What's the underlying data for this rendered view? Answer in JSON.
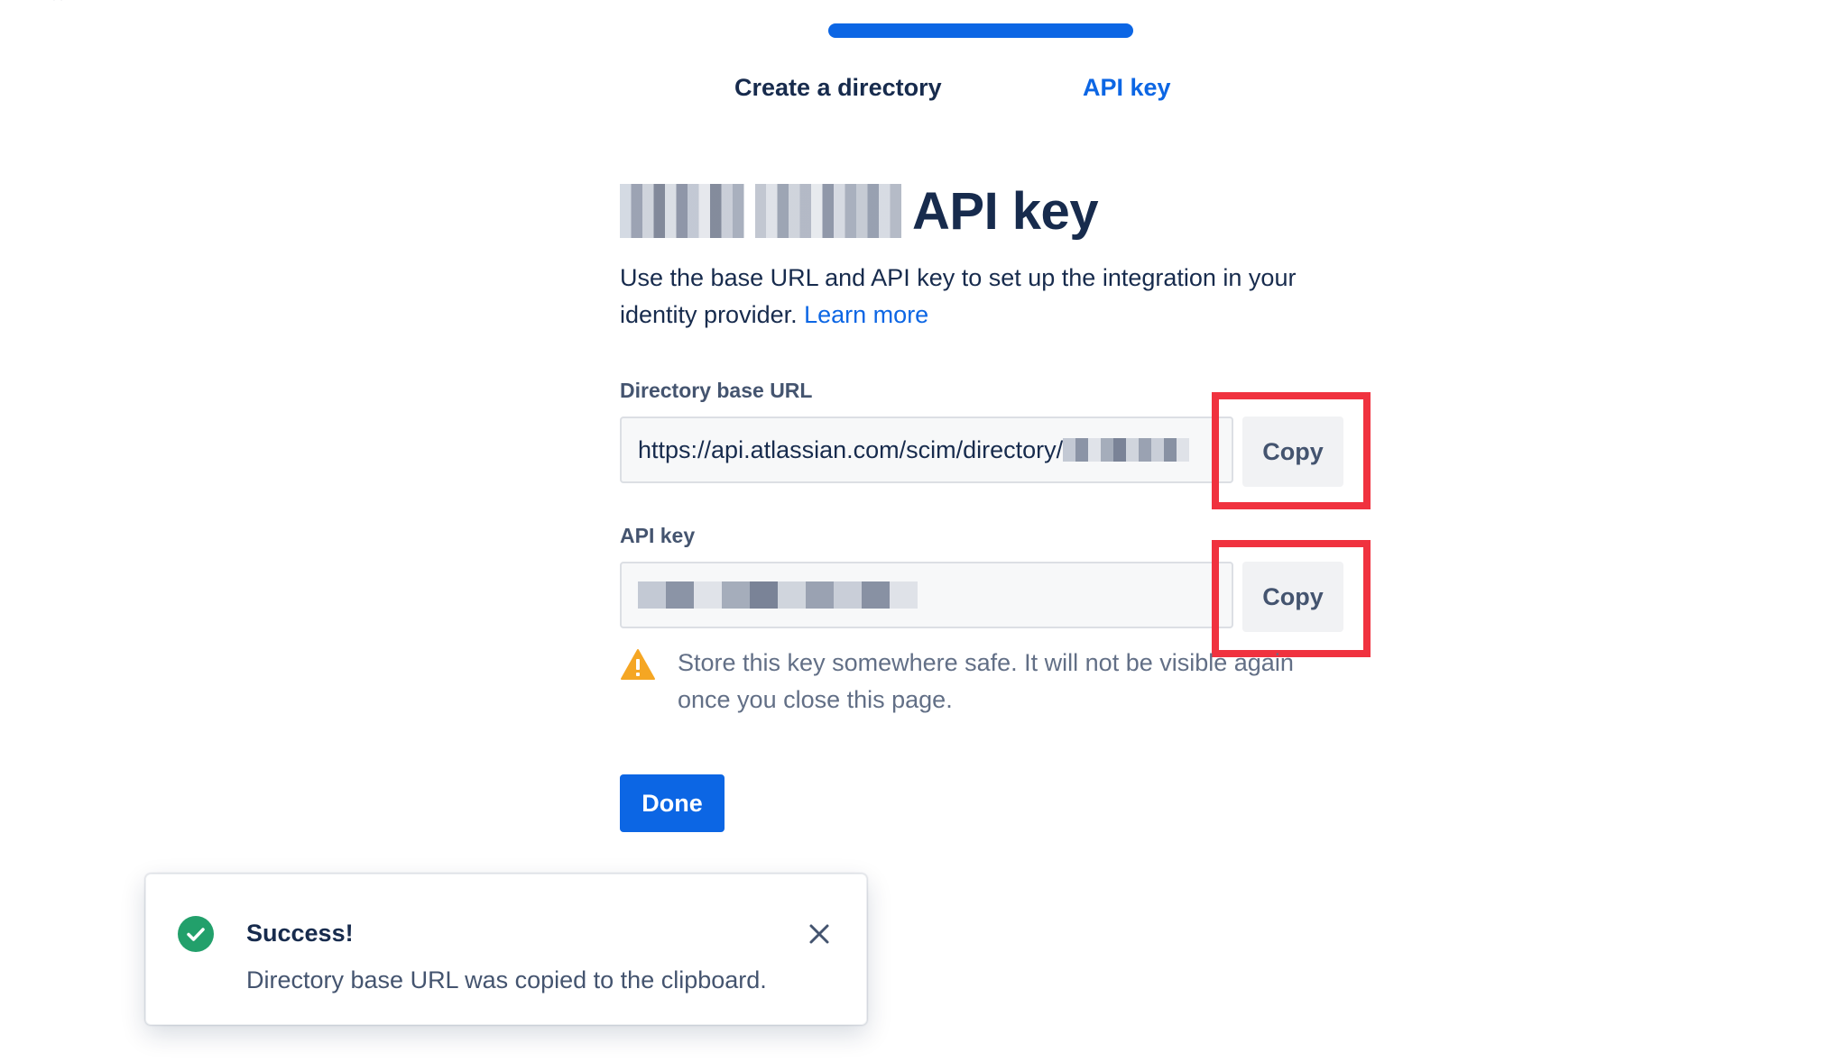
{
  "progress": {
    "value_fraction": 1.0,
    "color": "#0c66e4"
  },
  "steps": [
    {
      "label": "Create a directory",
      "state": "done"
    },
    {
      "label": "API key",
      "state": "current"
    }
  ],
  "page": {
    "title": "API key",
    "description": "Use the base URL and API key to set up the integration in your identity provider.",
    "learn_more": "Learn more"
  },
  "fields": {
    "url": {
      "label": "Directory base URL",
      "value": "https://api.atlassian.com/scim/directory/",
      "copy_label": "Copy"
    },
    "api_key": {
      "label": "API key",
      "copy_label": "Copy"
    }
  },
  "warning": {
    "text": "Store this key somewhere safe. It will not be visible again once you close this page.",
    "icon": "warning-icon"
  },
  "done_label": "Done",
  "toast": {
    "title": "Success!",
    "message": "Directory base URL was copied to the clipboard.",
    "icon": "check-circle-icon"
  },
  "colors": {
    "brand": "#0c66e4",
    "highlight": "#f0323f",
    "success": "#22a06b",
    "warning": "#f5a623"
  }
}
